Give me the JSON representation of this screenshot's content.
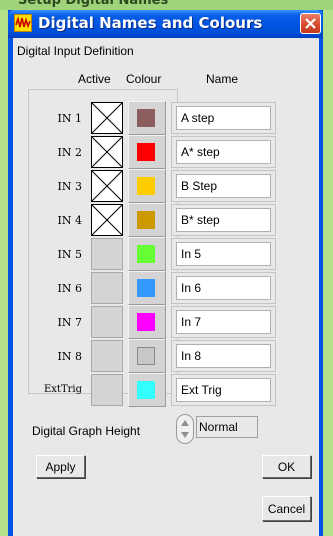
{
  "background": {
    "partial_text": "Setup Digital Names"
  },
  "window": {
    "title": "Digital Names and Colours",
    "title_icon": "waveform-icon",
    "close_icon": "close-icon"
  },
  "section": {
    "label": "Digital Input Definition"
  },
  "columns": {
    "active": "Active",
    "colour": "Colour",
    "name": "Name"
  },
  "rows": [
    {
      "label": "IN 1",
      "active": true,
      "colour": "#8c5e5e",
      "name": "A step"
    },
    {
      "label": "IN 2",
      "active": true,
      "colour": "#ff0000",
      "name": "A* step"
    },
    {
      "label": "IN 3",
      "active": true,
      "colour": "#ffcc00",
      "name": "B Step"
    },
    {
      "label": "IN 4",
      "active": true,
      "colour": "#cc9900",
      "name": "B* step"
    },
    {
      "label": "IN 5",
      "active": false,
      "colour": "#66ff33",
      "name": "In 5"
    },
    {
      "label": "IN 6",
      "active": false,
      "colour": "#3399ff",
      "name": "In 6"
    },
    {
      "label": "IN 7",
      "active": false,
      "colour": "#ff00ff",
      "name": "In 7"
    },
    {
      "label": "IN 8",
      "active": false,
      "colour": "#c8c8c8",
      "name": "In 8"
    },
    {
      "label": "ExtTrig",
      "active": false,
      "colour": "#33ffff",
      "name": "Ext Trig"
    }
  ],
  "graph_height": {
    "label": "Digital Graph Height",
    "value": "Normal"
  },
  "buttons": {
    "apply": "Apply",
    "ok": "OK",
    "cancel": "Cancel"
  }
}
